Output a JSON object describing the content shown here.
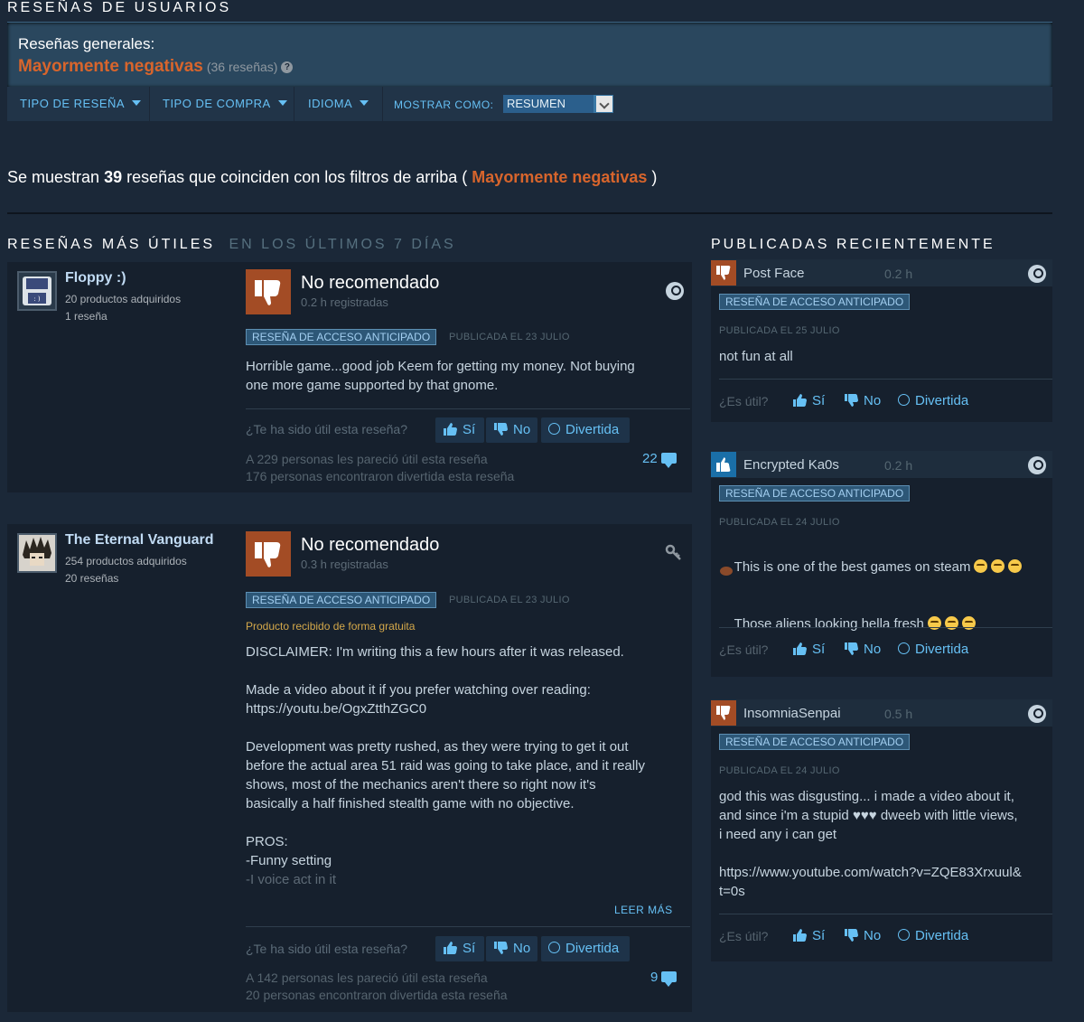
{
  "header": {
    "title": "RESEÑAS DE USUARIOS"
  },
  "summary": {
    "label": "Reseñas generales:",
    "rating": "Mayormente negativas",
    "count": "(36 reseñas)",
    "help_icon": "?"
  },
  "filters": {
    "review_type": "TIPO DE RESEÑA",
    "purchase_type": "TIPO DE COMPRA",
    "language": "IDIOMA",
    "show_as_label": "MOSTRAR COMO:",
    "show_as_value": "RESUMEN"
  },
  "results": {
    "prefix": "Se muestran ",
    "count": "39",
    "middle": " reseñas que coinciden con los filtros de arriba ( ",
    "rating": "Mayormente negativas",
    "suffix": " )"
  },
  "helpful_section": {
    "title": "RESEÑAS MÁS ÚTILES",
    "subtitle": "EN LOS ÚLTIMOS 7 DÍAS"
  },
  "recent_section": {
    "title": "PUBLICADAS RECIENTEMENTE"
  },
  "reviews": [
    {
      "user": "Floppy :)",
      "products": "20 productos adquiridos",
      "reviews": "1 reseña",
      "verdict": "No recomendado",
      "hours": "0.2 h registradas",
      "tag": "RESEÑA DE ACCESO ANTICIPADO",
      "posted": "PUBLICADA EL 23 JULIO",
      "text": "Horrible game...good job Keem for getting my money. Not buying\none more game supported by that gnome.",
      "helpful_q": "¿Te ha sido útil esta reseña?",
      "yes": "Sí",
      "no": "No",
      "funny": "Divertida",
      "helpful_count": "A 229 personas les pareció útil esta reseña",
      "funny_count": "176 personas encontraron divertida esta reseña",
      "comments": "22"
    },
    {
      "user": "The Eternal Vanguard",
      "products": "254 productos adquiridos",
      "reviews": "20 reseñas",
      "verdict": "No recomendado",
      "hours": "0.3 h registradas",
      "tag": "RESEÑA DE ACCESO ANTICIPADO",
      "posted": "PUBLICADA EL 23 JULIO",
      "free_note": "Producto recibido de forma gratuita",
      "text": "DISCLAIMER: I'm writing this a few hours after it was released.\n\nMade a video about it if you prefer watching over reading:\nhttps://youtu.be/OgxZtthZGC0\n\nDevelopment was pretty rushed, as they were trying to get it out\nbefore the actual area 51 raid was going to take place, and it really\nshows, most of the mechanics aren't there so right now it's\nbasically a half finished stealth game with no objective.\n\nPROS:\n-Funny setting",
      "text_faded": "-I voice act in it",
      "read_more": "LEER MÁS",
      "helpful_q": "¿Te ha sido útil esta reseña?",
      "yes": "Sí",
      "no": "No",
      "funny": "Divertida",
      "helpful_count": "A 142 personas les pareció útil esta reseña",
      "funny_count": "20 personas encontraron divertida esta reseña",
      "comments": "9"
    }
  ],
  "recent": [
    {
      "user": "Post Face",
      "hours": "0.2 h",
      "tag": "RESEÑA DE ACCESO ANTICIPADO",
      "posted": "PUBLICADA EL 25 JULIO",
      "text": "not fun at all",
      "helpful_q": "¿Es útil?",
      "yes": "Sí",
      "no": "No",
      "funny": "Divertida",
      "recommended": false
    },
    {
      "user": "Encrypted Ka0s",
      "hours": "0.2 h",
      "tag": "RESEÑA DE ACCESO ANTICIPADO",
      "posted": "PUBLICADA EL 24 JULIO",
      "text_line1": "This is one of the best games on steam",
      "text_line2": "Those aliens looking hella fresh",
      "helpful_q": "¿Es útil?",
      "yes": "Sí",
      "no": "No",
      "funny": "Divertida",
      "recommended": true
    },
    {
      "user": "InsomniaSenpai",
      "hours": "0.5 h",
      "tag": "RESEÑA DE ACCESO ANTICIPADO",
      "posted": "PUBLICADA EL 24 JULIO",
      "text": "god this was disgusting... i made a video about it,\nand since i'm a stupid ♥♥♥ dweeb with little views,\ni need any i can get\n\nhttps://www.youtube.com/watch?v=ZQE83Xrxuul&\nt=0s",
      "helpful_q": "¿Es útil?",
      "yes": "Sí",
      "no": "No",
      "funny": "Divertida",
      "recommended": false
    }
  ],
  "colors": {
    "background": "#1b2838",
    "negative": "#d8652c",
    "link": "#66c0f4",
    "thumb_down_bg": "#a34c25",
    "thumb_up_bg": "#1a6fa8"
  }
}
